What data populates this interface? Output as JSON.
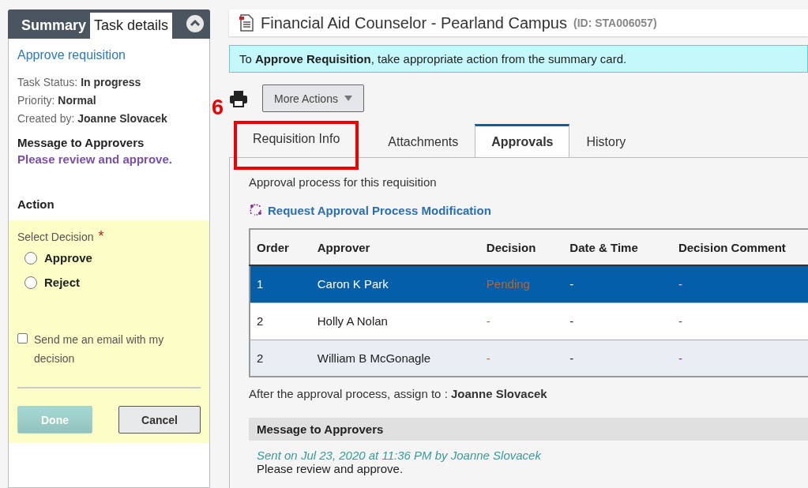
{
  "side_panel": {
    "tabs": [
      {
        "label": "Summary",
        "selected": false
      },
      {
        "label": "Task details",
        "selected": true
      }
    ],
    "task_title": "Approve requisition",
    "details": [
      {
        "label": "Task Status:",
        "value": "In progress"
      },
      {
        "label": "Priority:",
        "value": "Normal"
      },
      {
        "label": "Created by:",
        "value": "Joanne Slovacek"
      }
    ],
    "message_heading": "Message to Approvers",
    "message": "Please review and approve.",
    "action_heading": "Action",
    "decision": {
      "label": "Select Decision",
      "required_mark": "*",
      "options": [
        {
          "label": "Approve",
          "selected": false
        },
        {
          "label": "Reject",
          "selected": false
        }
      ]
    },
    "email_option": {
      "label": "Send me an email with my decision",
      "checked": false
    },
    "buttons": [
      {
        "label": "Done",
        "kind": "primary",
        "disabled": true
      },
      {
        "label": "Cancel",
        "kind": "secondary",
        "disabled": false
      }
    ]
  },
  "header": {
    "title": "Financial Aid Counselor - Pearland Campus",
    "id": "(ID: STA006057)"
  },
  "banner": "To **Approve Requisition**, take appropriate action from the summary card.",
  "toolbar": {
    "more_actions": "More Actions"
  },
  "annotation": {
    "label": "6"
  },
  "tabs": [
    {
      "label": "Requisition Info",
      "selected": false,
      "highlighted": true
    },
    {
      "label": "Attachments",
      "selected": false,
      "highlighted": false
    },
    {
      "label": "Approvals",
      "selected": true,
      "highlighted": false
    },
    {
      "label": "History",
      "selected": false,
      "highlighted": false
    }
  ],
  "approvals": {
    "intro": "Approval process for this requisition",
    "modify_link": "Request Approval Process Modification",
    "table": {
      "columns": [
        "Order",
        "Approver",
        "Decision",
        "Date & Time",
        "Decision Comment"
      ],
      "rows": [
        {
          "cells": [
            "1",
            "Caron K Park",
            "Pending",
            "-",
            "-"
          ],
          "selected": true
        },
        {
          "cells": [
            "2",
            "Holly A Nolan",
            "-",
            "-",
            "-"
          ],
          "selected": false
        },
        {
          "cells": [
            "2",
            "William B McGonagle",
            "-",
            "-",
            "-"
          ],
          "selected": false
        }
      ]
    },
    "assign_note": "After the approval process, assign to : **Joanne Slovacek**",
    "message_section": {
      "heading": "Message to Approvers",
      "sent": "Sent on Jul 23, 2020 at 11:36 PM by Joanne Slovacek",
      "body": "Please review and approve."
    }
  }
}
